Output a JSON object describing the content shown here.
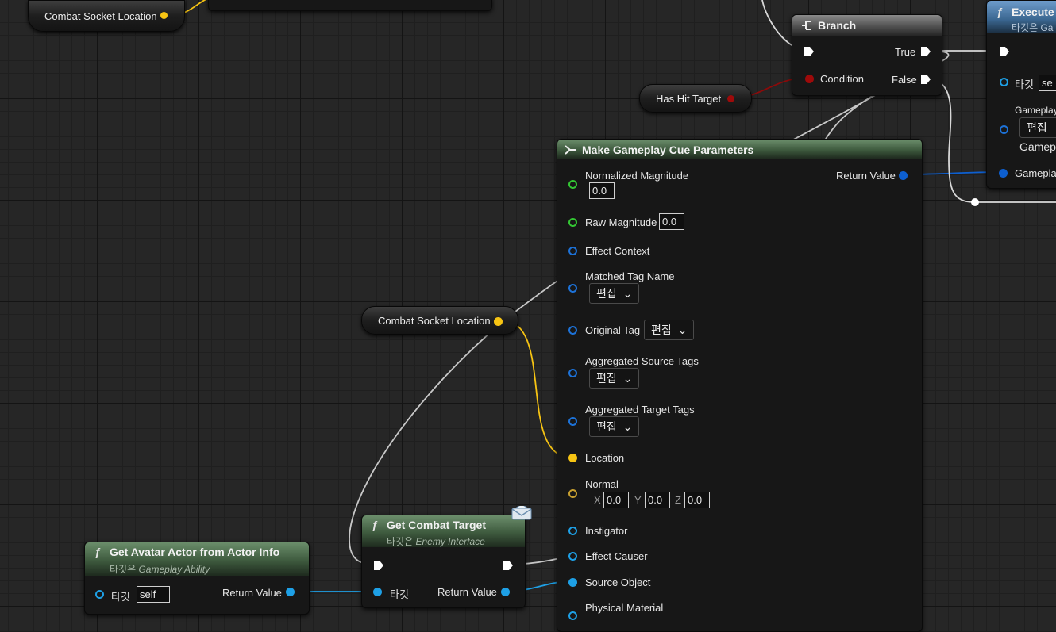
{
  "colors": {
    "exec": "#ffffff",
    "vector": "#f7c413",
    "bool": "#9e0a0a",
    "struct": "#0d5fd0",
    "object": "#1ea0e6",
    "float": "#33c633",
    "tag": "#1d72d8",
    "rotator": "#c8a030"
  },
  "icons": [
    "function-icon",
    "branch-icon",
    "struct-icon",
    "envelope-icon"
  ],
  "top_pill": {
    "label": "Combat Socket Location"
  },
  "mid_pill": {
    "label": "Combat Socket Location"
  },
  "has_hit_target": {
    "label": "Has Hit Target"
  },
  "branch": {
    "title": "Branch",
    "true_label": "True",
    "false_label": "False",
    "condition_label": "Condition"
  },
  "execute": {
    "title": "Execute",
    "subtitle": "타깃은 Ga",
    "target_label": "타깃",
    "target_value": "se",
    "gameplay_label": "Gameplay",
    "edit_label": "편집",
    "gamep_label": "Gamep",
    "gameplay2_label": "Gameplay"
  },
  "make_cue": {
    "title": "Make Gameplay Cue Parameters",
    "return_label": "Return Value",
    "normalized_magnitude": {
      "label": "Normalized Magnitude",
      "value": "0.0"
    },
    "raw_magnitude": {
      "label": "Raw Magnitude",
      "value": "0.0"
    },
    "effect_context": "Effect Context",
    "matched_tag_name": {
      "label": "Matched Tag Name",
      "value": "편집"
    },
    "original_tag": {
      "label": "Original Tag",
      "value": "편집"
    },
    "aggregated_source": {
      "label": "Aggregated Source Tags",
      "value": "편집"
    },
    "aggregated_target": {
      "label": "Aggregated Target Tags",
      "value": "편집"
    },
    "location": "Location",
    "normal": {
      "label": "Normal",
      "x_label": "X",
      "x": "0.0",
      "y_label": "Y",
      "y": "0.0",
      "z_label": "Z",
      "z": "0.0"
    },
    "instigator": "Instigator",
    "effect_causer": "Effect Causer",
    "source_object": "Source Object",
    "physical_material": "Physical Material"
  },
  "get_combat_target": {
    "title": "Get Combat Target",
    "subtitle_prefix": "타깃은 ",
    "subtitle_value": "Enemy Interface",
    "target_label": "타깃",
    "return_label": "Return Value"
  },
  "get_avatar": {
    "title": "Get Avatar Actor from Actor Info",
    "subtitle_prefix": "타깃은 ",
    "subtitle_value": "Gameplay Ability",
    "target_label": "타깃",
    "target_value": "self",
    "return_label": "Return Value"
  }
}
